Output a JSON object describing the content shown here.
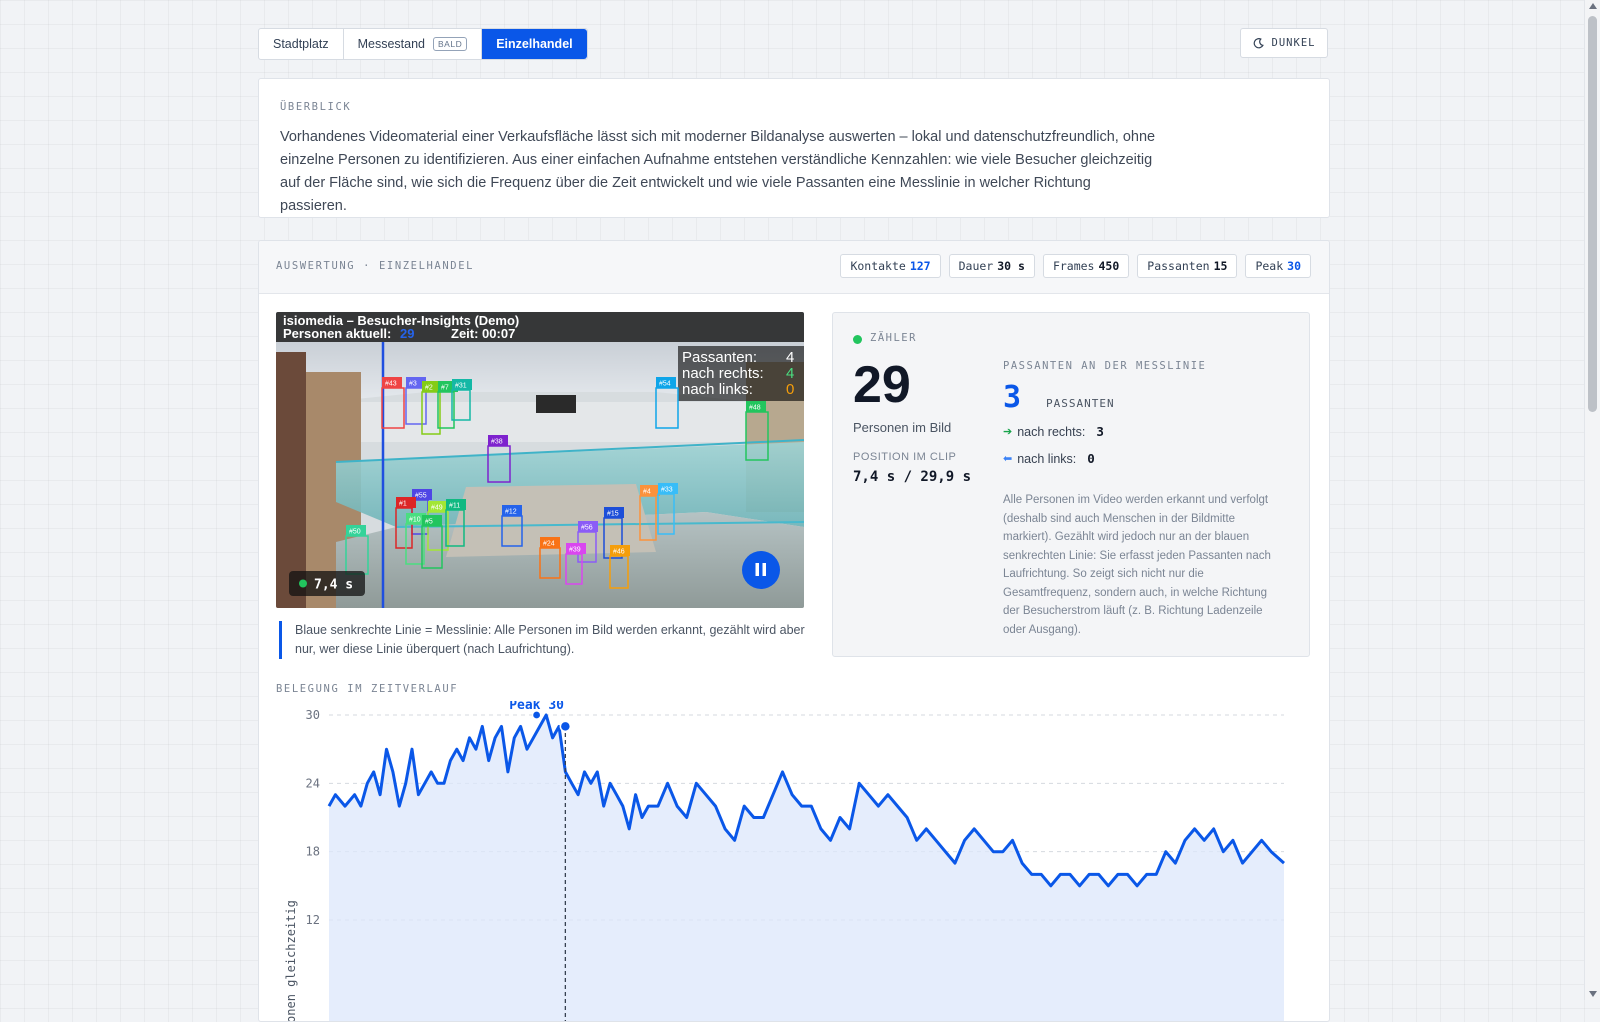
{
  "tabs": [
    {
      "label": "Stadtplatz"
    },
    {
      "label": "Messestand",
      "badge": "BALD"
    },
    {
      "label": "Einzelhandel",
      "active": true
    }
  ],
  "theme_button": {
    "label": "DUNKEL",
    "icon": "moon-icon"
  },
  "overview": {
    "label": "ÜBERBLICK",
    "text": "Vorhandenes Videomaterial einer Verkaufsfläche lässt sich mit moderner Bildanalyse auswerten – lokal und datenschutzfreundlich, ohne einzelne Personen zu identifizieren. Aus einer einfachen Aufnahme entstehen verständliche Kennzahlen: wie viele Besucher gleichzeitig auf der Fläche sind, wie sich die Frequenz über die Zeit entwickelt und wie viele Passanten eine Messlinie in welcher Richtung passieren."
  },
  "analysis": {
    "label": "AUSWERTUNG · EINZELHANDEL",
    "stats": [
      {
        "label": "Kontakte",
        "value": "127",
        "accent": true
      },
      {
        "label": "Dauer",
        "value": "30 s"
      },
      {
        "label": "Frames",
        "value": "450"
      },
      {
        "label": "Passanten",
        "value": "15"
      },
      {
        "label": "Peak",
        "value": "30",
        "accent": true
      }
    ]
  },
  "video": {
    "overlay_title": "isiomedia – Besucher-Insights (Demo)",
    "overlay_persons_label": "Personen aktuell:",
    "overlay_persons_value": "29",
    "overlay_time": "Zeit: 00:07",
    "box_passanten": "Passanten:",
    "box_passanten_value": "4",
    "box_rechts": "nach rechts:",
    "box_rechts_value": "4",
    "box_links": "nach links:",
    "box_links_value": "0",
    "time_badge": "7,4 s",
    "detections": [
      {
        "id": "43",
        "color": "#ef4444"
      },
      {
        "id": "3",
        "color": "#6366f1"
      },
      {
        "id": "2",
        "color": "#84cc16"
      },
      {
        "id": "7",
        "color": "#22c55e"
      },
      {
        "id": "31",
        "color": "#14b8a6"
      },
      {
        "id": "54",
        "color": "#0ea5e9"
      },
      {
        "id": "48",
        "color": "#22c55e"
      },
      {
        "id": "38",
        "color": "#7e22ce"
      },
      {
        "id": "55",
        "color": "#4f46e5"
      },
      {
        "id": "1",
        "color": "#dc2626"
      },
      {
        "id": "49",
        "color": "#a3e635"
      },
      {
        "id": "11",
        "color": "#10b981"
      },
      {
        "id": "12",
        "color": "#2563eb"
      },
      {
        "id": "10",
        "color": "#4ade80"
      },
      {
        "id": "5",
        "color": "#22c55e"
      },
      {
        "id": "50",
        "color": "#34d399"
      },
      {
        "id": "15",
        "color": "#1d4ed8"
      },
      {
        "id": "56",
        "color": "#8b5cf6"
      },
      {
        "id": "24",
        "color": "#f97316"
      },
      {
        "id": "39",
        "color": "#d946ef"
      },
      {
        "id": "46",
        "color": "#f59e0b"
      },
      {
        "id": "4",
        "color": "#fb923c"
      },
      {
        "id": "33",
        "color": "#38bdf8"
      }
    ]
  },
  "legend_note": "Blaue senkrechte Linie = Messlinie: Alle Personen im Bild werden erkannt, gezählt wird aber nur, wer diese Linie überquert (nach Laufrichtung).",
  "counter": {
    "label": "ZÄHLER",
    "value": "29",
    "value_caption": "Personen im Bild",
    "position_label": "POSITION IM CLIP",
    "position_value": "7,4 s / 29,9 s",
    "passanten_label": "PASSANTEN AN DER MESSLINIE",
    "passanten_value": "3",
    "passanten_unit": "PASSANTEN",
    "right_label": "nach rechts:",
    "right_value": "3",
    "left_label": "nach links:",
    "left_value": "0",
    "description": "Alle Personen im Video werden erkannt und verfolgt (deshalb sind auch Menschen in der Bildmitte markiert). Gezählt wird jedoch nur an der blauen senkrechten Linie: Sie erfasst jeden Passanten nach Laufrichtung. So zeigt sich nicht nur die Gesamtfrequenz, sondern auch, in welche Richtung der Besucherstrom läuft (z. B. Richtung Ladenzeile oder Ausgang)."
  },
  "timeline": {
    "label": "BELEGUNG IM ZEITVERLAUF"
  },
  "chart_data": {
    "type": "area",
    "ylabel": "Personen gleichzeitig",
    "xlabel": "",
    "yticks": [
      12,
      18,
      24,
      30
    ],
    "ylim": [
      9.5,
      31
    ],
    "xlim": [
      0,
      29.9
    ],
    "grid": true,
    "current_time": 7.4,
    "peak": {
      "label": "Peak 30",
      "x": 6.5,
      "y": 30
    },
    "line_color": "#0a57e8",
    "fill_color": "#dce7fb",
    "x": [
      0,
      0.2,
      0.5,
      0.8,
      1.0,
      1.2,
      1.4,
      1.6,
      1.8,
      2.0,
      2.2,
      2.4,
      2.6,
      2.8,
      3.0,
      3.2,
      3.4,
      3.6,
      3.8,
      4.0,
      4.2,
      4.4,
      4.6,
      4.8,
      5.0,
      5.2,
      5.4,
      5.6,
      5.8,
      6.0,
      6.2,
      6.4,
      6.6,
      6.8,
      7.0,
      7.2,
      7.4,
      7.6,
      7.8,
      8.0,
      8.2,
      8.4,
      8.6,
      8.8,
      9.0,
      9.2,
      9.4,
      9.6,
      9.8,
      10.0,
      10.3,
      10.6,
      10.9,
      11.2,
      11.5,
      11.8,
      12.1,
      12.4,
      12.7,
      13.0,
      13.3,
      13.6,
      13.9,
      14.2,
      14.5,
      14.8,
      15.1,
      15.4,
      15.7,
      16.0,
      16.3,
      16.6,
      16.9,
      17.2,
      17.5,
      17.8,
      18.1,
      18.4,
      18.7,
      19.0,
      19.3,
      19.6,
      19.9,
      20.2,
      20.5,
      20.8,
      21.1,
      21.4,
      21.7,
      22.0,
      22.3,
      22.6,
      22.9,
      23.2,
      23.5,
      23.8,
      24.1,
      24.4,
      24.7,
      25.0,
      25.3,
      25.6,
      25.9,
      26.2,
      26.5,
      26.8,
      27.1,
      27.4,
      27.7,
      28.0,
      28.3,
      28.6,
      28.9,
      29.2,
      29.5,
      29.9
    ],
    "y": [
      22,
      23,
      22,
      23,
      22,
      24,
      25,
      23,
      27,
      25,
      22,
      24,
      27,
      23,
      24,
      25,
      24,
      24,
      26,
      27,
      26,
      28,
      27,
      29,
      26,
      28,
      29,
      25,
      28,
      29,
      27,
      28,
      29,
      30,
      28,
      29,
      25,
      24,
      23,
      25,
      24,
      25,
      22,
      24,
      23,
      22,
      20,
      23,
      21,
      22,
      22,
      24,
      22,
      21,
      24,
      23,
      22,
      20,
      19,
      22,
      21,
      21,
      23,
      25,
      23,
      22,
      22,
      20,
      19,
      21,
      20,
      24,
      23,
      22,
      23,
      22,
      21,
      19,
      20,
      19,
      18,
      17,
      19,
      20,
      19,
      18,
      18,
      19,
      17,
      16,
      16,
      15,
      16,
      16,
      15,
      16,
      16,
      15,
      16,
      16,
      15,
      16,
      16,
      18,
      17,
      19,
      20,
      19,
      20,
      18,
      19,
      17,
      18,
      19,
      18,
      17,
      18
    ]
  }
}
